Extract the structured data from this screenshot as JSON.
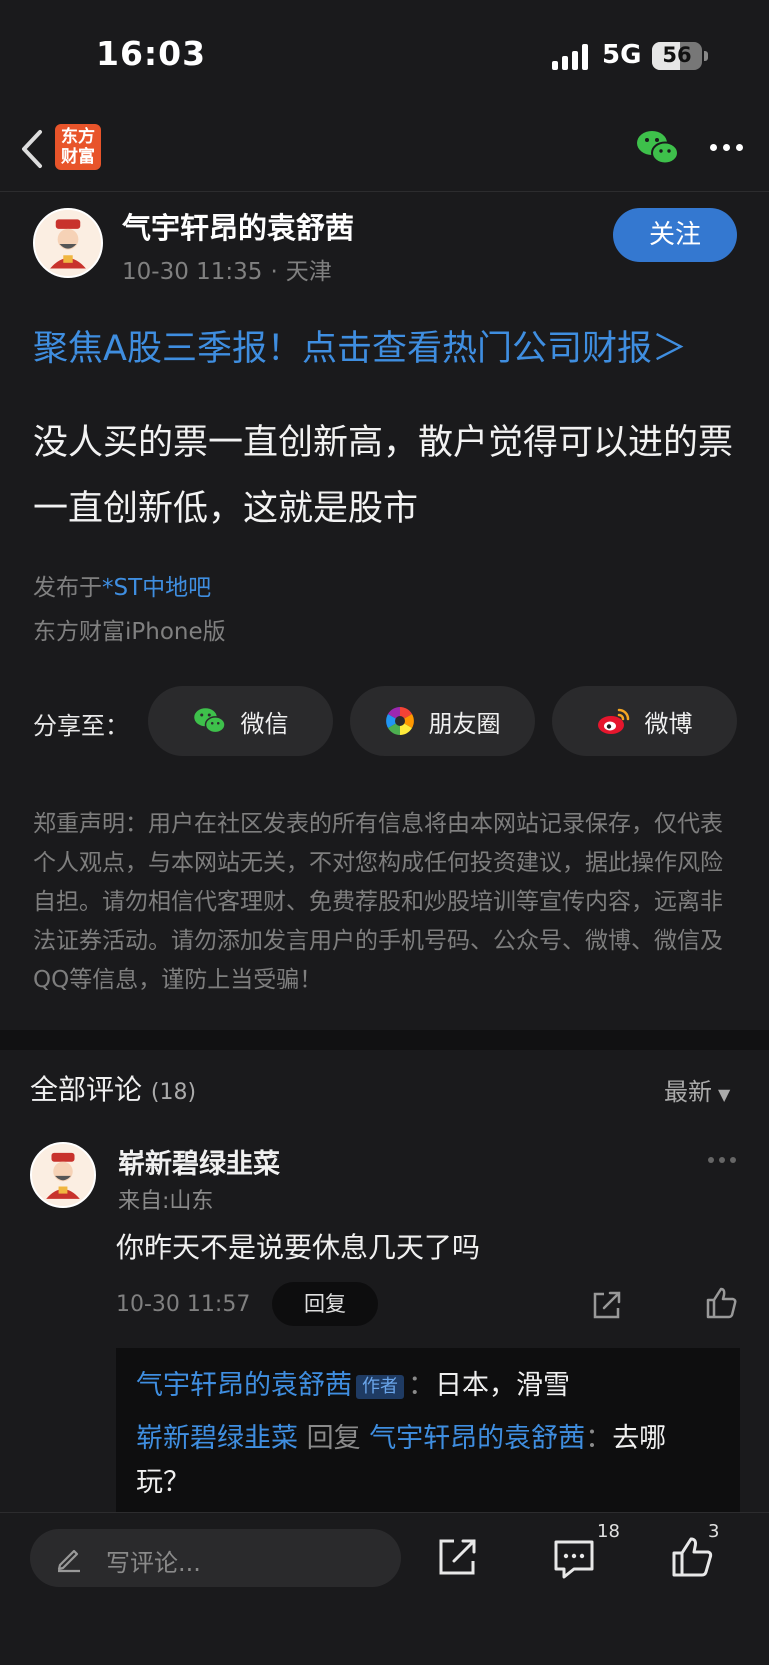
{
  "status": {
    "time": "16:03",
    "network": "5G",
    "battery": "56",
    "battery_fraction": 0.56
  },
  "nav": {
    "logo_line1": "东方",
    "logo_line2": "财富"
  },
  "author": {
    "name": "气宇轩昂的袁舒茜",
    "date": "10-30 11:35",
    "dot": "·",
    "location": "天津",
    "follow_label": "关注"
  },
  "promo": "聚焦A股三季报！点击查看热门公司财报＞",
  "post": {
    "title": "没人买的票一直创新高，散户觉得可以进的票一直创新低，这就是股市",
    "posted_prefix": "发布于",
    "bar_name": "*ST中地吧",
    "device": "东方财富iPhone版"
  },
  "share": {
    "label": "分享至：",
    "buttons": [
      "微信",
      "朋友圈",
      "微博"
    ]
  },
  "disclaimer": "郑重声明：用户在社区发表的所有信息将由本网站记录保存，仅代表个人观点，与本网站无关，不对您构成任何投资建议，据此操作风险自担。请勿相信代客理财、免费荐股和炒股培训等宣传内容，远离非法证券活动。请勿添加发言用户的手机号码、公众号、微博、微信及QQ等信息，谨防上当受骗！",
  "comments": {
    "header": "全部评论",
    "count": "(18)",
    "sort": "最新",
    "items": [
      {
        "user": "崭新碧绿韭菜",
        "location": "来自:山东",
        "text": "你昨天不是说要休息几天了吗",
        "time": "10-30 11:57",
        "reply_label": "回复",
        "replies": [
          {
            "user": "气宇轩昂的袁舒茜",
            "tag": "作者",
            "sep": "：",
            "text": "日本，滑雪"
          },
          {
            "user": "崭新碧绿韭菜",
            "verb": "回复",
            "target": "气宇轩昂的袁舒茜",
            "sep": "：",
            "text": "去哪玩？"
          }
        ]
      }
    ]
  },
  "bottom": {
    "placeholder": "写评论...",
    "comment_count": "18",
    "like_count": "3"
  },
  "colors": {
    "accent": "#3f8ee0",
    "follow": "#3478d0",
    "background": "#1a1a1c",
    "brand": "#e8542a"
  }
}
